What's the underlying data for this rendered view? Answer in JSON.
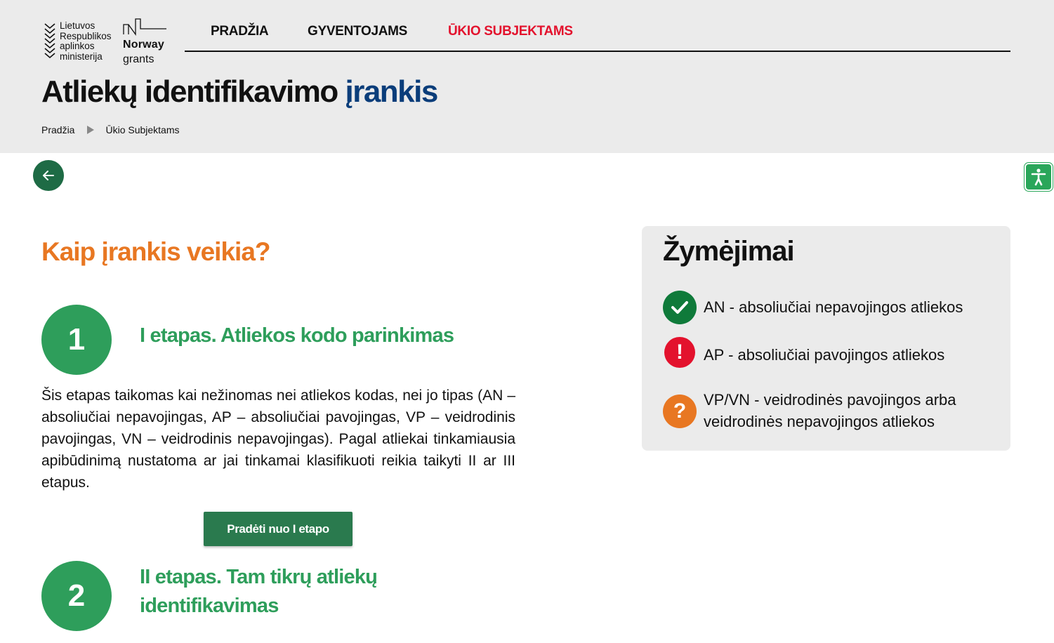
{
  "logos": {
    "ministry_lines": [
      "Lietuvos",
      "Respublikos",
      "aplinkos",
      "ministerija"
    ],
    "norway_line1": "Norway",
    "norway_line2": "grants"
  },
  "nav": {
    "items": [
      {
        "label": "PRADŽIA",
        "active": false
      },
      {
        "label": "GYVENTOJAMS",
        "active": false
      },
      {
        "label": "ŪKIO SUBJEKTAMS",
        "active": true
      }
    ]
  },
  "page": {
    "title_main": "Atliekų identifikavimo ",
    "title_accent": "įrankis",
    "breadcrumb": [
      "Pradžia",
      "Ūkio Subjektams"
    ]
  },
  "content": {
    "section_title": "Kaip įrankis veikia?",
    "steps": [
      {
        "number": "1",
        "title": "I etapas. Atliekos kodo parinkimas",
        "description": "Šis etapas taikomas kai nežinomas nei atliekos kodas, nei jo tipas (AN – absoliučiai nepavojingas, AP – absoliučiai pavojingas, VP – veidrodinis pavojingas, VN – veidrodinis nepavojingas). Pagal atliekai tinkamiausia apibūdinimą nustatoma ar jai tinkamai klasifikuoti reikia taikyti II ar III etapus.",
        "button_label": "Pradėti nuo I etapo"
      },
      {
        "number": "2",
        "title": "II etapas. Tam tikrų atliekų identifikavimas"
      }
    ]
  },
  "legend": {
    "title": "Žymėjimai",
    "items": [
      {
        "icon": "check-icon",
        "color": "#0f7a3a",
        "text": "AN - absoliučiai nepavojingos atliekos"
      },
      {
        "icon": "exclamation-icon",
        "color": "#e3122d",
        "text": "AP - absoliučiai pavojingos atliekos"
      },
      {
        "icon": "question-icon",
        "color": "#e87722",
        "text": "VP/VN - veidrodinės pavojingos arba veidrodinės nepavojingos atliekos"
      }
    ]
  },
  "colors": {
    "primary_green": "#2e9e5b",
    "dark_green": "#1e6b45",
    "orange": "#e87722",
    "red": "#e3122d",
    "navy": "#0a3d7a"
  }
}
